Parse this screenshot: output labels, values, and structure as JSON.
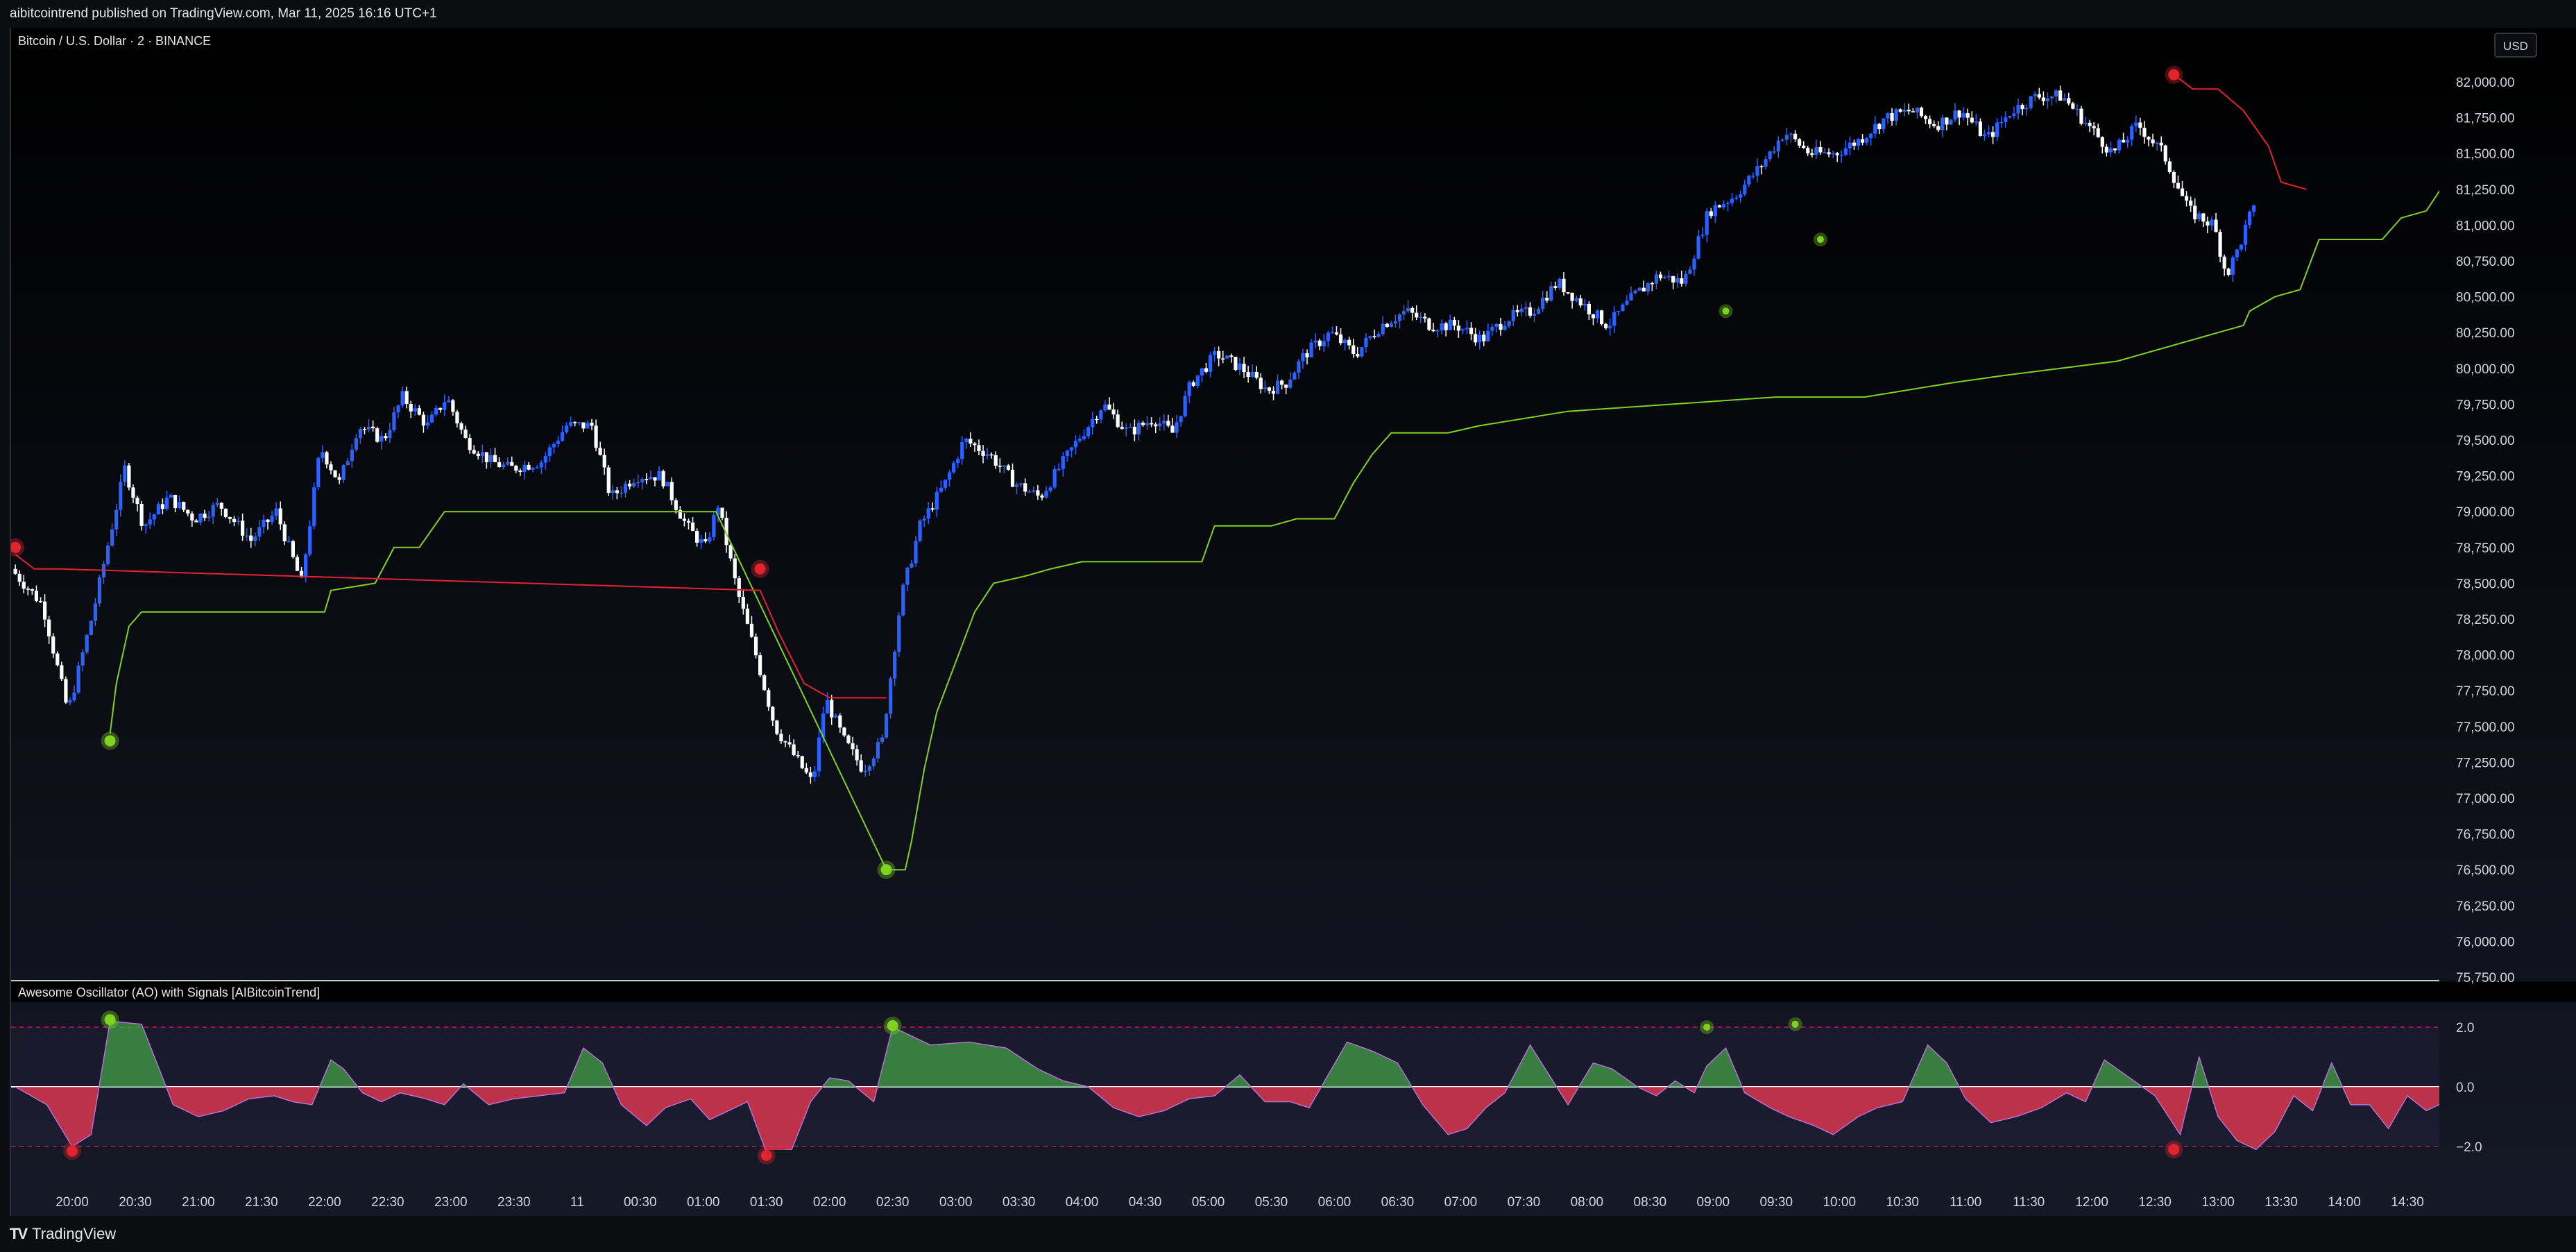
{
  "header": {
    "published": "aibitcointrend published on TradingView.com, Mar 11, 2025 16:16 UTC+1"
  },
  "footer": {
    "brand": "TradingView",
    "logo_text": "TV"
  },
  "colors": {
    "background_top": "#000000",
    "background_bottom": "#151826",
    "candle_up": "#2962ff",
    "candle_down": "#ffffff",
    "support_line": "#7ed321",
    "resistance_line": "#e0242d",
    "buy_signal": "#7ed321",
    "sell_signal": "#e0242d",
    "osc_positive": "#43a047",
    "osc_negative": "#e53950",
    "osc_line": "#b76fd6",
    "zero_line": "#ffffff",
    "band_line": "#c2185b"
  },
  "chart_data": [
    {
      "type": "line",
      "title": "Bitcoin / U.S. Dollar · 2 · BINANCE",
      "currency_button": "USD",
      "price_axis": {
        "ticks": [
          "82,000.00",
          "81,750.00",
          "81,500.00",
          "81,250.00",
          "81,000.00",
          "80,750.00",
          "80,500.00",
          "80,250.00",
          "80,000.00",
          "79,750.00",
          "79,500.00",
          "79,250.00",
          "79,000.00",
          "78,750.00",
          "78,500.00",
          "78,250.00",
          "78,000.00",
          "77,750.00",
          "77,500.00",
          "77,250.00",
          "77,000.00",
          "76,750.00",
          "76,500.00",
          "76,250.00",
          "76,000.00",
          "75,750.00"
        ],
        "ylim": [
          75750,
          82000
        ]
      },
      "time_axis": {
        "ticks": [
          "20:00",
          "20:30",
          "21:00",
          "21:30",
          "22:00",
          "22:30",
          "23:00",
          "23:30",
          "11",
          "00:30",
          "01:00",
          "01:30",
          "02:00",
          "02:30",
          "03:00",
          "03:30",
          "04:00",
          "04:30",
          "05:00",
          "05:30",
          "06:00",
          "06:30",
          "07:00",
          "07:30",
          "08:00",
          "08:30",
          "09:00",
          "09:30",
          "10:00",
          "10:30",
          "11:00",
          "11:30",
          "12:00",
          "12:30",
          "13:00",
          "13:30",
          "14:00",
          "14:30"
        ],
        "start_hour": 20.0,
        "end_hour": 38.5
      },
      "price_series": [
        [
          19.55,
          78600
        ],
        [
          19.8,
          78350
        ],
        [
          20.0,
          77600
        ],
        [
          20.2,
          78300
        ],
        [
          20.35,
          78900
        ],
        [
          20.45,
          79300
        ],
        [
          20.6,
          78900
        ],
        [
          20.8,
          79100
        ],
        [
          21.0,
          78950
        ],
        [
          21.2,
          79050
        ],
        [
          21.45,
          78800
        ],
        [
          21.65,
          79000
        ],
        [
          21.85,
          78500
        ],
        [
          22.0,
          79450
        ],
        [
          22.15,
          79200
        ],
        [
          22.3,
          79600
        ],
        [
          22.5,
          79500
        ],
        [
          22.65,
          79800
        ],
        [
          22.85,
          79600
        ],
        [
          23.0,
          79800
        ],
        [
          23.15,
          79500
        ],
        [
          23.35,
          79350
        ],
        [
          23.5,
          79300
        ],
        [
          23.75,
          79350
        ],
        [
          23.95,
          79600
        ],
        [
          24.15,
          79600
        ],
        [
          24.3,
          79100
        ],
        [
          24.5,
          79250
        ],
        [
          24.7,
          79250
        ],
        [
          24.9,
          78900
        ],
        [
          25.05,
          78750
        ],
        [
          25.15,
          79050
        ],
        [
          25.3,
          78450
        ],
        [
          25.45,
          78000
        ],
        [
          25.6,
          77500
        ],
        [
          25.75,
          77300
        ],
        [
          25.9,
          77100
        ],
        [
          26.0,
          77700
        ],
        [
          26.15,
          77400
        ],
        [
          26.3,
          77200
        ],
        [
          26.45,
          77400
        ],
        [
          26.6,
          78400
        ],
        [
          26.75,
          78900
        ],
        [
          26.95,
          79200
        ],
        [
          27.1,
          79500
        ],
        [
          27.3,
          79400
        ],
        [
          27.5,
          79200
        ],
        [
          27.7,
          79100
        ],
        [
          27.85,
          79300
        ],
        [
          28.0,
          79500
        ],
        [
          28.2,
          79750
        ],
        [
          28.4,
          79550
        ],
        [
          28.6,
          79650
        ],
        [
          28.75,
          79550
        ],
        [
          28.9,
          79900
        ],
        [
          29.1,
          80100
        ],
        [
          29.3,
          80000
        ],
        [
          29.5,
          79850
        ],
        [
          29.65,
          79900
        ],
        [
          29.8,
          80100
        ],
        [
          30.0,
          80250
        ],
        [
          30.2,
          80100
        ],
        [
          30.4,
          80300
        ],
        [
          30.6,
          80400
        ],
        [
          30.8,
          80300
        ],
        [
          31.0,
          80300
        ],
        [
          31.2,
          80200
        ],
        [
          31.4,
          80350
        ],
        [
          31.6,
          80400
        ],
        [
          31.8,
          80600
        ],
        [
          32.0,
          80450
        ],
        [
          32.2,
          80300
        ],
        [
          32.4,
          80500
        ],
        [
          32.6,
          80650
        ],
        [
          32.8,
          80600
        ],
        [
          33.0,
          81100
        ],
        [
          33.2,
          81200
        ],
        [
          33.4,
          81400
        ],
        [
          33.6,
          81650
        ],
        [
          33.8,
          81500
        ],
        [
          34.0,
          81500
        ],
        [
          34.2,
          81600
        ],
        [
          34.4,
          81750
        ],
        [
          34.6,
          81800
        ],
        [
          34.8,
          81700
        ],
        [
          35.0,
          81800
        ],
        [
          35.2,
          81600
        ],
        [
          35.4,
          81800
        ],
        [
          35.6,
          81900
        ],
        [
          35.8,
          81900
        ],
        [
          36.0,
          81700
        ],
        [
          36.2,
          81500
        ],
        [
          36.4,
          81700
        ],
        [
          36.6,
          81500
        ],
        [
          36.8,
          81100
        ],
        [
          37.0,
          81000
        ],
        [
          37.1,
          80650
        ],
        [
          37.2,
          80850
        ],
        [
          37.3,
          81100
        ]
      ],
      "support_series": [
        [
          20.3,
          77450
        ],
        [
          20.35,
          77800
        ],
        [
          20.45,
          78200
        ],
        [
          20.55,
          78300
        ],
        [
          21.45,
          78300
        ],
        [
          22.0,
          78300
        ],
        [
          22.05,
          78450
        ],
        [
          22.4,
          78500
        ],
        [
          22.55,
          78750
        ],
        [
          22.75,
          78750
        ],
        [
          22.95,
          79000
        ],
        [
          23.2,
          79000
        ],
        [
          25.1,
          79000
        ],
        [
          26.45,
          76500
        ],
        [
          26.6,
          76500
        ],
        [
          26.65,
          76700
        ],
        [
          26.75,
          77200
        ],
        [
          26.85,
          77600
        ],
        [
          27.0,
          77950
        ],
        [
          27.15,
          78300
        ],
        [
          27.3,
          78500
        ],
        [
          27.55,
          78550
        ],
        [
          27.75,
          78600
        ],
        [
          28.0,
          78650
        ],
        [
          28.95,
          78650
        ],
        [
          29.05,
          78900
        ],
        [
          29.5,
          78900
        ],
        [
          29.7,
          78950
        ],
        [
          30.0,
          78950
        ],
        [
          30.15,
          79200
        ],
        [
          30.3,
          79400
        ],
        [
          30.45,
          79550
        ],
        [
          30.9,
          79550
        ],
        [
          31.15,
          79600
        ],
        [
          31.85,
          79700
        ],
        [
          33.5,
          79800
        ],
        [
          34.2,
          79800
        ],
        [
          34.9,
          79900
        ],
        [
          35.3,
          79950
        ],
        [
          36.2,
          80050
        ],
        [
          37.0,
          80250
        ],
        [
          37.2,
          80300
        ],
        [
          37.25,
          80400
        ],
        [
          37.45,
          80500
        ],
        [
          37.65,
          80550
        ],
        [
          37.8,
          80900
        ],
        [
          38.3,
          80900
        ],
        [
          38.45,
          81050
        ],
        [
          38.65,
          81100
        ],
        [
          38.8,
          81300
        ],
        [
          38.95,
          81350
        ],
        [
          39.15,
          81400
        ],
        [
          39.7,
          81450
        ],
        [
          40.0,
          81600
        ],
        [
          40.8,
          81600
        ],
        [
          40.9,
          81550
        ]
      ],
      "resistance_series": [
        [
          19.55,
          78700
        ],
        [
          19.7,
          78600
        ],
        [
          19.9,
          78600
        ],
        [
          25.45,
          78450
        ],
        [
          25.6,
          78150
        ],
        [
          25.8,
          77800
        ],
        [
          26.0,
          77700
        ],
        [
          26.45,
          77700
        ],
        [
          36.65,
          82050
        ],
        [
          36.8,
          81950
        ],
        [
          37.0,
          81950
        ],
        [
          37.2,
          81800
        ],
        [
          37.4,
          81550
        ],
        [
          37.5,
          81300
        ],
        [
          37.7,
          81250
        ]
      ],
      "buy_signals": [
        [
          20.3,
          77400
        ],
        [
          26.45,
          76500
        ],
        [
          33.1,
          80400
        ],
        [
          33.85,
          80900
        ]
      ],
      "sell_signals": [
        [
          19.55,
          78750
        ],
        [
          25.45,
          78600
        ],
        [
          36.65,
          82050
        ]
      ]
    },
    {
      "type": "area",
      "title": "Awesome Oscillator (AO) with Signals [AIBitcoinTrend]",
      "y_ticks": [
        "2.0",
        "0.0",
        "−2.0"
      ],
      "ylim": [
        -2.5,
        2.5
      ],
      "bands": [
        2.0,
        0.0,
        -2.0
      ],
      "series": [
        [
          19.55,
          0.0
        ],
        [
          19.8,
          -0.6
        ],
        [
          20.0,
          -2.0
        ],
        [
          20.15,
          -1.6
        ],
        [
          20.3,
          2.2
        ],
        [
          20.55,
          2.1
        ],
        [
          20.8,
          -0.6
        ],
        [
          21.0,
          -1.0
        ],
        [
          21.2,
          -0.8
        ],
        [
          21.4,
          -0.4
        ],
        [
          21.6,
          -0.3
        ],
        [
          21.75,
          -0.5
        ],
        [
          21.9,
          -0.6
        ],
        [
          22.05,
          0.9
        ],
        [
          22.15,
          0.6
        ],
        [
          22.3,
          -0.2
        ],
        [
          22.45,
          -0.5
        ],
        [
          22.6,
          -0.2
        ],
        [
          22.8,
          -0.4
        ],
        [
          22.95,
          -0.6
        ],
        [
          23.1,
          0.1
        ],
        [
          23.3,
          -0.6
        ],
        [
          23.5,
          -0.4
        ],
        [
          23.7,
          -0.3
        ],
        [
          23.9,
          -0.2
        ],
        [
          24.05,
          1.3
        ],
        [
          24.2,
          0.8
        ],
        [
          24.35,
          -0.6
        ],
        [
          24.55,
          -1.3
        ],
        [
          24.7,
          -0.7
        ],
        [
          24.9,
          -0.4
        ],
        [
          25.05,
          -1.1
        ],
        [
          25.2,
          -0.8
        ],
        [
          25.35,
          -0.5
        ],
        [
          25.5,
          -2.2
        ],
        [
          25.7,
          -2.1
        ],
        [
          25.85,
          -0.5
        ],
        [
          26.0,
          0.3
        ],
        [
          26.15,
          0.2
        ],
        [
          26.35,
          -0.5
        ],
        [
          26.5,
          2.0
        ],
        [
          26.8,
          1.4
        ],
        [
          27.1,
          1.5
        ],
        [
          27.4,
          1.3
        ],
        [
          27.65,
          0.6
        ],
        [
          27.85,
          0.2
        ],
        [
          28.05,
          0.0
        ],
        [
          28.25,
          -0.7
        ],
        [
          28.45,
          -1.0
        ],
        [
          28.65,
          -0.8
        ],
        [
          28.85,
          -0.4
        ],
        [
          29.05,
          -0.3
        ],
        [
          29.25,
          0.4
        ],
        [
          29.45,
          -0.5
        ],
        [
          29.65,
          -0.5
        ],
        [
          29.8,
          -0.7
        ],
        [
          29.95,
          0.4
        ],
        [
          30.1,
          1.5
        ],
        [
          30.3,
          1.2
        ],
        [
          30.5,
          0.8
        ],
        [
          30.7,
          -0.6
        ],
        [
          30.9,
          -1.6
        ],
        [
          31.05,
          -1.4
        ],
        [
          31.2,
          -0.7
        ],
        [
          31.35,
          -0.2
        ],
        [
          31.55,
          1.4
        ],
        [
          31.7,
          0.4
        ],
        [
          31.85,
          -0.6
        ],
        [
          32.05,
          0.8
        ],
        [
          32.2,
          0.6
        ],
        [
          32.4,
          0.0
        ],
        [
          32.55,
          -0.3
        ],
        [
          32.7,
          0.2
        ],
        [
          32.85,
          -0.2
        ],
        [
          32.95,
          0.7
        ],
        [
          33.1,
          1.3
        ],
        [
          33.25,
          -0.2
        ],
        [
          33.45,
          -0.7
        ],
        [
          33.6,
          -1.0
        ],
        [
          33.8,
          -1.3
        ],
        [
          33.95,
          -1.6
        ],
        [
          34.15,
          -1.0
        ],
        [
          34.3,
          -0.7
        ],
        [
          34.5,
          -0.5
        ],
        [
          34.7,
          1.4
        ],
        [
          34.85,
          0.8
        ],
        [
          35.0,
          -0.4
        ],
        [
          35.2,
          -1.2
        ],
        [
          35.4,
          -1.0
        ],
        [
          35.6,
          -0.7
        ],
        [
          35.8,
          -0.2
        ],
        [
          35.95,
          -0.5
        ],
        [
          36.1,
          0.9
        ],
        [
          36.3,
          0.3
        ],
        [
          36.5,
          -0.3
        ],
        [
          36.7,
          -1.6
        ],
        [
          36.85,
          1.0
        ],
        [
          37.0,
          -1.0
        ],
        [
          37.15,
          -1.8
        ],
        [
          37.3,
          -2.1
        ],
        [
          37.45,
          -1.5
        ],
        [
          37.6,
          -0.3
        ],
        [
          37.75,
          -0.8
        ],
        [
          37.9,
          0.8
        ],
        [
          38.05,
          -0.6
        ],
        [
          38.2,
          -0.6
        ],
        [
          38.35,
          -1.4
        ],
        [
          38.5,
          -0.3
        ],
        [
          38.65,
          -0.8
        ],
        [
          38.8,
          -0.5
        ],
        [
          38.95,
          -0.3
        ],
        [
          39.1,
          1.0
        ],
        [
          39.3,
          0.4
        ],
        [
          39.45,
          1.1
        ],
        [
          39.6,
          -0.5
        ],
        [
          39.75,
          -1.2
        ],
        [
          39.9,
          -1.5
        ],
        [
          40.1,
          -1.1
        ],
        [
          40.3,
          -0.6
        ],
        [
          40.45,
          1.0
        ],
        [
          40.6,
          -0.5
        ],
        [
          40.75,
          -0.9
        ],
        [
          40.85,
          -1.8
        ],
        [
          40.95,
          -1.2
        ]
      ],
      "buy_signals": [
        [
          20.3,
          2.25
        ],
        [
          26.5,
          2.05
        ],
        [
          32.95,
          2.0
        ],
        [
          33.65,
          2.1
        ]
      ],
      "sell_signals": [
        [
          20.0,
          -2.15
        ],
        [
          25.5,
          -2.3
        ],
        [
          36.65,
          -2.1
        ]
      ]
    }
  ]
}
